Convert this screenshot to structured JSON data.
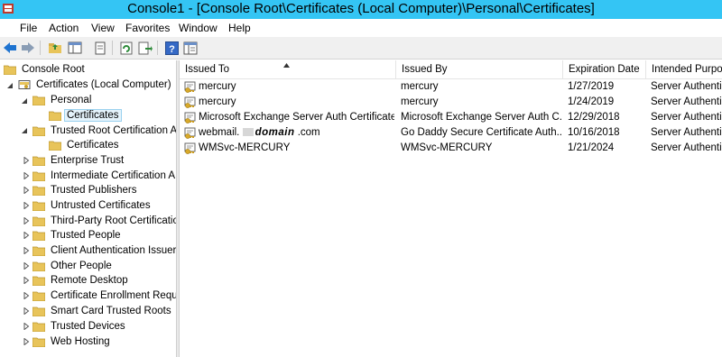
{
  "window": {
    "title": "Console1 - [Console Root\\Certificates (Local Computer)\\Personal\\Certificates]"
  },
  "menu": [
    "File",
    "Action",
    "View",
    "Favorites",
    "Window",
    "Help"
  ],
  "toolbar": [
    "back-icon",
    "forward-icon",
    "up-folder-icon",
    "show-hide-tree-icon",
    "copy-icon",
    "refresh-icon",
    "export-list-icon",
    "help-icon",
    "properties-icon"
  ],
  "tree": {
    "root": "Console Root",
    "computer": "Certificates (Local Computer)",
    "personal": "Personal",
    "personal_certs": "Certificates",
    "trusted_root": "Trusted Root Certification A",
    "trusted_root_certs": "Certificates",
    "stores": [
      "Enterprise Trust",
      "Intermediate Certification A",
      "Trusted Publishers",
      "Untrusted Certificates",
      "Third-Party Root Certificatio",
      "Trusted People",
      "Client Authentication Issuer",
      "Other People",
      "Remote Desktop",
      "Certificate Enrollment Requ",
      "Smart Card Trusted Roots",
      "Trusted Devices",
      "Web Hosting"
    ]
  },
  "list": {
    "columns": [
      "Issued To",
      "Issued By",
      "Expiration Date",
      "Intended Purpo"
    ],
    "rows": [
      [
        "mercury",
        "mercury",
        "1/27/2019",
        "Server Authenticat"
      ],
      [
        "mercury",
        "mercury",
        "1/24/2019",
        "Server Authenticat"
      ],
      [
        "Microsoft Exchange Server Auth Certificate",
        "Microsoft Exchange Server Auth C...",
        "12/29/2018",
        "Server Authenticat"
      ],
      [
        "webmail.",
        "Go Daddy Secure Certificate Auth...",
        "10/16/2018",
        "Server Authenticat"
      ],
      [
        "WMSvc-MERCURY",
        "WMSvc-MERCURY",
        "1/21/2024",
        "Server Authenticat"
      ]
    ],
    "redacted_domain": "domain",
    "redacted_suffix": ".com"
  },
  "colors": {
    "titlebar": "#34c5f4",
    "folder": "#e8c45a",
    "selection": "#e5f3fb"
  }
}
